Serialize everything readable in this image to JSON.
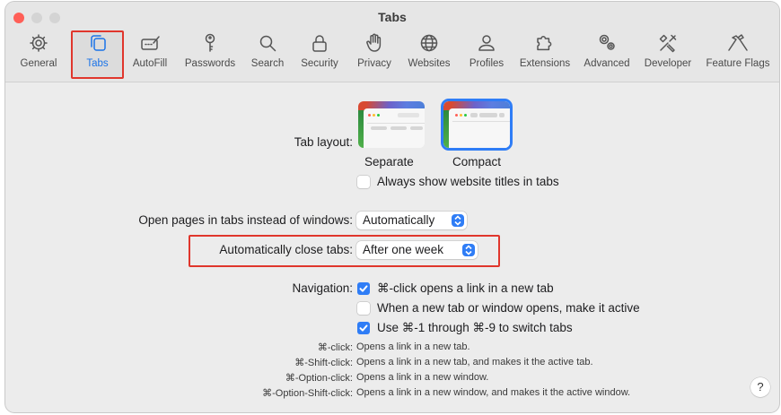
{
  "window": {
    "title": "Tabs"
  },
  "toolbar": {
    "items": [
      {
        "label": "General",
        "icon": "gear-icon"
      },
      {
        "label": "Tabs",
        "icon": "tabs-icon"
      },
      {
        "label": "AutoFill",
        "icon": "autofill-icon"
      },
      {
        "label": "Passwords",
        "icon": "key-icon"
      },
      {
        "label": "Search",
        "icon": "search-icon"
      },
      {
        "label": "Security",
        "icon": "lock-icon"
      },
      {
        "label": "Privacy",
        "icon": "hand-icon"
      },
      {
        "label": "Websites",
        "icon": "globe-icon"
      },
      {
        "label": "Profiles",
        "icon": "person-icon"
      },
      {
        "label": "Extensions",
        "icon": "puzzle-icon"
      },
      {
        "label": "Advanced",
        "icon": "gears-icon"
      },
      {
        "label": "Developer",
        "icon": "tools-icon"
      },
      {
        "label": "Feature Flags",
        "icon": "flags-icon"
      }
    ],
    "selected": "Tabs"
  },
  "tab_layout": {
    "label": "Tab layout:",
    "options": [
      {
        "label": "Separate"
      },
      {
        "label": "Compact"
      }
    ],
    "selected": "Compact",
    "always_show_titles": {
      "label": "Always show website titles in tabs",
      "checked": false
    }
  },
  "open_pages": {
    "label": "Open pages in tabs instead of windows:",
    "value": "Automatically"
  },
  "auto_close": {
    "label": "Automatically close tabs:",
    "value": "After one week"
  },
  "navigation": {
    "label": "Navigation:",
    "options": [
      {
        "label": "⌘-click opens a link in a new tab",
        "checked": true
      },
      {
        "label": "When a new tab or window opens, make it active",
        "checked": false
      },
      {
        "label": "Use ⌘-1 through ⌘-9 to switch tabs",
        "checked": true
      }
    ]
  },
  "shortcuts": [
    {
      "key": "⌘-click:",
      "desc": "Opens a link in a new tab."
    },
    {
      "key": "⌘-Shift-click:",
      "desc": "Opens a link in a new tab, and makes it the active tab."
    },
    {
      "key": "⌘-Option-click:",
      "desc": "Opens a link in a new window."
    },
    {
      "key": "⌘-Option-Shift-click:",
      "desc": "Opens a link in a new window, and makes it the active window."
    }
  ],
  "help": {
    "label": "?"
  },
  "colors": {
    "accent": "#2f7df6",
    "annotation": "#e0362c",
    "close": "#ff5f57"
  }
}
